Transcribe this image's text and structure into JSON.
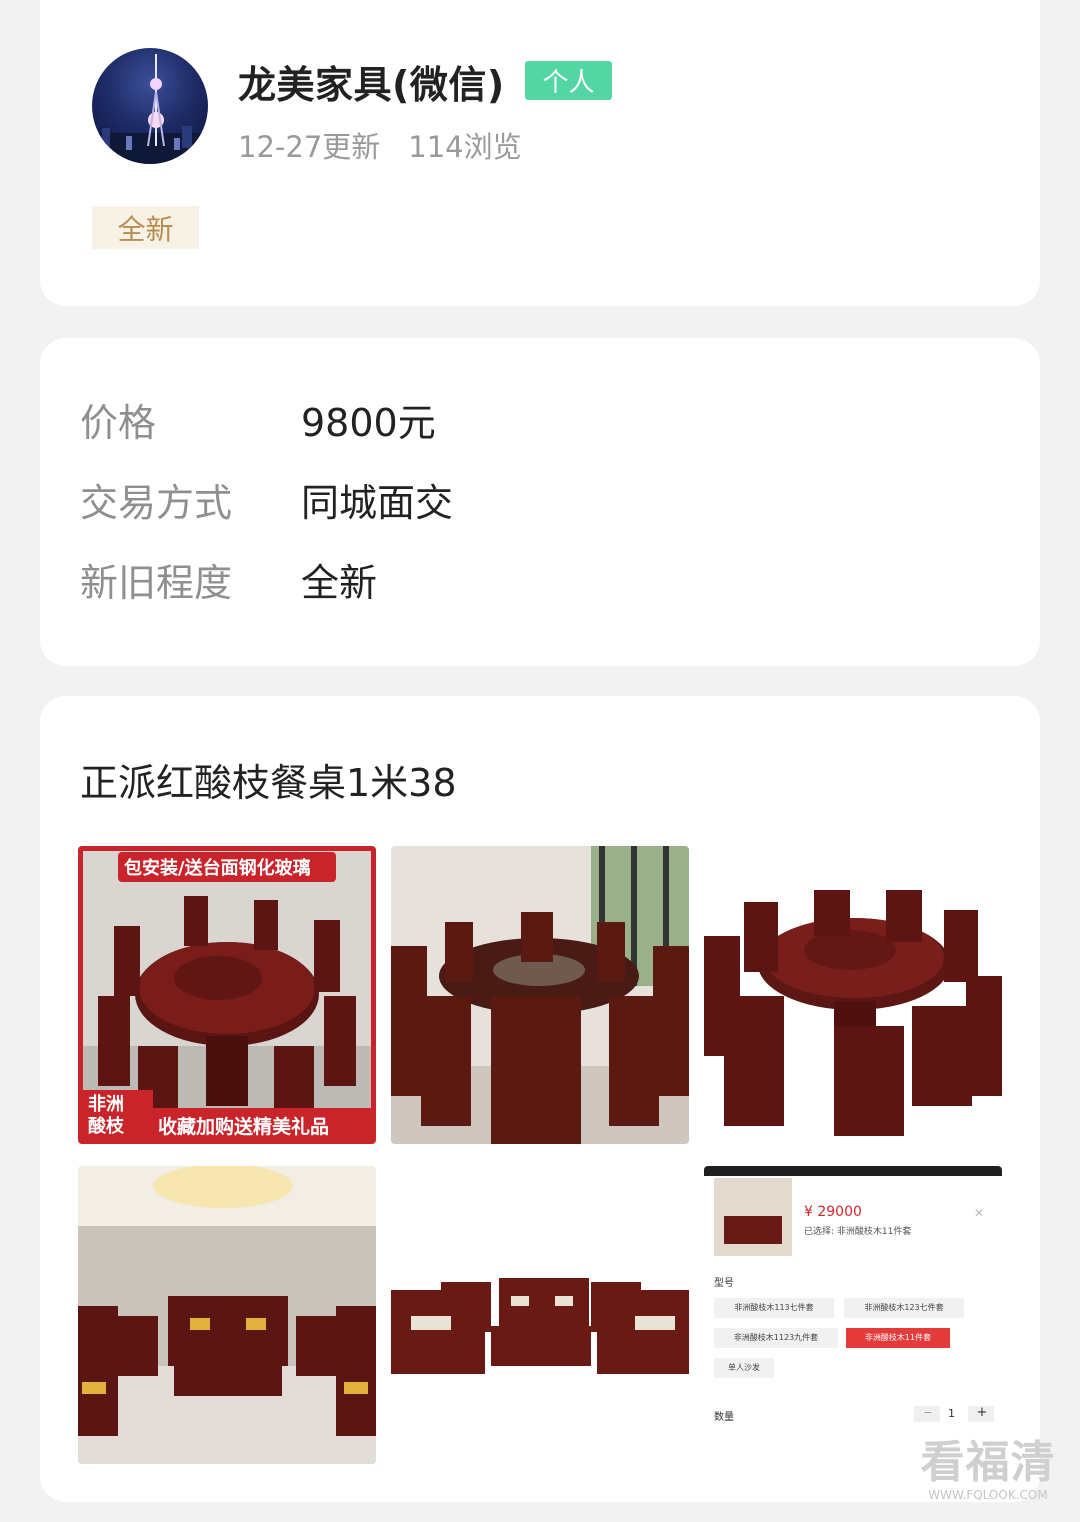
{
  "seller": {
    "name": "龙美家具(微信)",
    "badge": "个人",
    "updated": "12-27更新",
    "views": "114浏览",
    "condition_tag": "全新"
  },
  "info": [
    {
      "label": "价格",
      "value": "9800元"
    },
    {
      "label": "交易方式",
      "value": "同城面交"
    },
    {
      "label": "新旧程度",
      "value": "全新"
    }
  ],
  "description": {
    "title": "正派红酸枝餐桌1米38"
  },
  "photos": {
    "p1": {
      "banner": "包安装/送台面钢化玻璃",
      "corner": "非洲\n酸枝",
      "footer": "收藏加购送精美礼品"
    },
    "p6": {
      "price": "¥ 29000",
      "selected": "已选择: 非洲酸枝木11件套",
      "model_label": "型号",
      "options": [
        "非洲酸枝木113七件套",
        "非洲酸枝木123七件套",
        "非洲酸枝木1123九件套",
        "非洲酸枝木11件套",
        "单人沙发"
      ],
      "qty_label": "数量",
      "qty_value": "1",
      "minus": "−",
      "plus": "+"
    }
  },
  "watermark": {
    "big": "看福清",
    "small": "WWW.FQLOOK.COM"
  },
  "colors": {
    "accent_green": "#53d6a4",
    "tag_bg": "#f8f1e6",
    "tag_text": "#b98d4f",
    "red": "#c8242a",
    "wood": "#5a1412"
  }
}
